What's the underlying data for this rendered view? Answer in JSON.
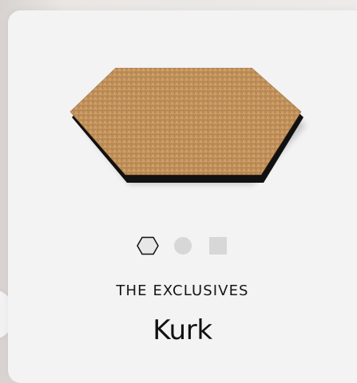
{
  "product": {
    "brand": "THE EXCLUSIVES",
    "name": "Kurk",
    "image_icon": "hexagon-cork-coaster",
    "colors": {
      "cork": "#c4945a",
      "cork_dark": "#8d6437",
      "edge": "#111111",
      "background": "#f3f3f3",
      "swatch_gray": "#d7d7d7"
    }
  },
  "shape_options": [
    {
      "name": "hexagon",
      "selected": true
    },
    {
      "name": "circle",
      "selected": false
    },
    {
      "name": "square",
      "selected": false
    }
  ]
}
